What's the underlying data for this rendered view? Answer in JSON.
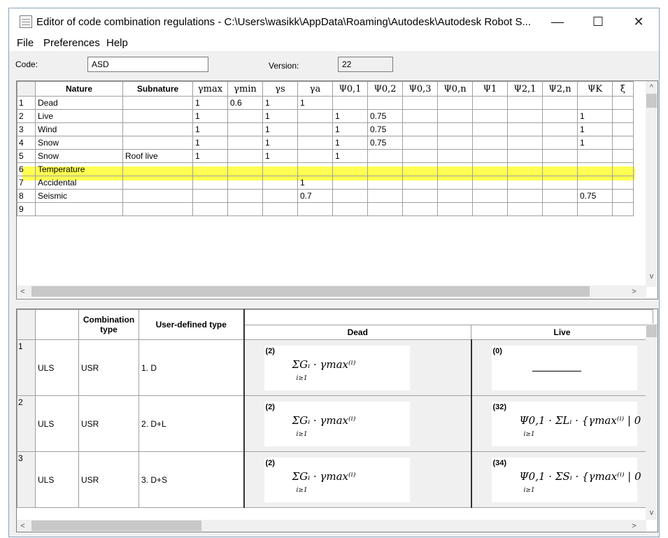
{
  "window": {
    "title": "Editor of code combination regulations - C:\\Users\\wasikk\\AppData\\Roaming\\Autodesk\\Autodesk Robot S...",
    "minimize": "—",
    "maximize": "☐",
    "close": "✕"
  },
  "menu": [
    "File",
    "Preferences",
    "Help"
  ],
  "code": {
    "label": "Code:",
    "value": "ASD"
  },
  "version": {
    "label": "Version:",
    "value": "22"
  },
  "natures_grid": {
    "headers": [
      "Nature",
      "Subnature",
      "γmax",
      "γmin",
      "γs",
      "γa",
      "Ψ0,1",
      "Ψ0,2",
      "Ψ0,3",
      "Ψ0,n",
      "Ψ1",
      "Ψ2,1",
      "Ψ2,n",
      "ΨK",
      "ξ"
    ],
    "rows": [
      {
        "num": "1",
        "cells": [
          "Dead",
          "",
          "1",
          "0.6",
          "1",
          "1",
          "",
          "",
          "",
          "",
          "",
          "",
          "",
          "",
          ""
        ]
      },
      {
        "num": "2",
        "cells": [
          "Live",
          "",
          "1",
          "",
          "1",
          "",
          "1",
          "0.75",
          "",
          "",
          "",
          "",
          "",
          "1",
          ""
        ]
      },
      {
        "num": "3",
        "cells": [
          "Wind",
          "",
          "1",
          "",
          "1",
          "",
          "1",
          "0.75",
          "",
          "",
          "",
          "",
          "",
          "1",
          ""
        ]
      },
      {
        "num": "4",
        "cells": [
          "Snow",
          "",
          "1",
          "",
          "1",
          "",
          "1",
          "0.75",
          "",
          "",
          "",
          "",
          "",
          "1",
          ""
        ]
      },
      {
        "num": "5",
        "cells": [
          "Snow",
          "Roof live",
          "1",
          "",
          "1",
          "",
          "1",
          "",
          "",
          "",
          "",
          "",
          "",
          "",
          ""
        ]
      },
      {
        "num": "6",
        "cells": [
          "Temperature",
          "",
          "",
          "",
          "",
          "",
          "",
          "",
          "",
          "",
          "",
          "",
          "",
          "",
          ""
        ]
      },
      {
        "num": "7",
        "cells": [
          "Accidental",
          "",
          "",
          "",
          "",
          "1",
          "",
          "",
          "",
          "",
          "",
          "",
          "",
          "",
          ""
        ]
      },
      {
        "num": "8",
        "cells": [
          "Seismic",
          "",
          "",
          "",
          "",
          "0.7",
          "",
          "",
          "",
          "",
          "",
          "",
          "",
          "0.75",
          ""
        ]
      },
      {
        "num": "9",
        "cells": [
          "",
          "",
          "",
          "",
          "",
          "",
          "",
          "",
          "",
          "",
          "",
          "",
          "",
          "",
          ""
        ]
      }
    ],
    "highlighted_row": "6"
  },
  "combinations_grid": {
    "headers": {
      "combination_type": "Combination type",
      "user_defined_type": "User-defined type",
      "dead": "Dead",
      "live": "Live"
    },
    "rows": [
      {
        "num": "1",
        "limit": "ULS",
        "ctype": "USR",
        "udt": "1. D",
        "dead": {
          "code": "(2)",
          "formula": "ΣGᵢ · γmax⁽ⁱ⁾",
          "sub": "i≥1"
        },
        "live": {
          "code": "(0)",
          "formula": "",
          "sub": ""
        }
      },
      {
        "num": "2",
        "limit": "ULS",
        "ctype": "USR",
        "udt": "2. D+L",
        "dead": {
          "code": "(2)",
          "formula": "ΣGᵢ · γmax⁽ⁱ⁾",
          "sub": "i≥1"
        },
        "live": {
          "code": "(32)",
          "formula": "Ψ0,1 · ΣLᵢ · {γmax⁽ⁱ⁾ | 0",
          "sub": "i≥1"
        }
      },
      {
        "num": "3",
        "limit": "ULS",
        "ctype": "USR",
        "udt": "3. D+S",
        "dead": {
          "code": "(2)",
          "formula": "ΣGᵢ · γmax⁽ⁱ⁾",
          "sub": "i≥1"
        },
        "live": {
          "code": "(34)",
          "formula": "Ψ0,1 · ΣSᵢ · {γmax⁽ⁱ⁾ | 0",
          "sub": "i≥1"
        }
      }
    ]
  },
  "scroll": {
    "up": "^",
    "down": "v",
    "left": "<",
    "right": ">"
  },
  "colors": {
    "highlight": "#ffff33",
    "window_bg": "#f0f0f0"
  }
}
